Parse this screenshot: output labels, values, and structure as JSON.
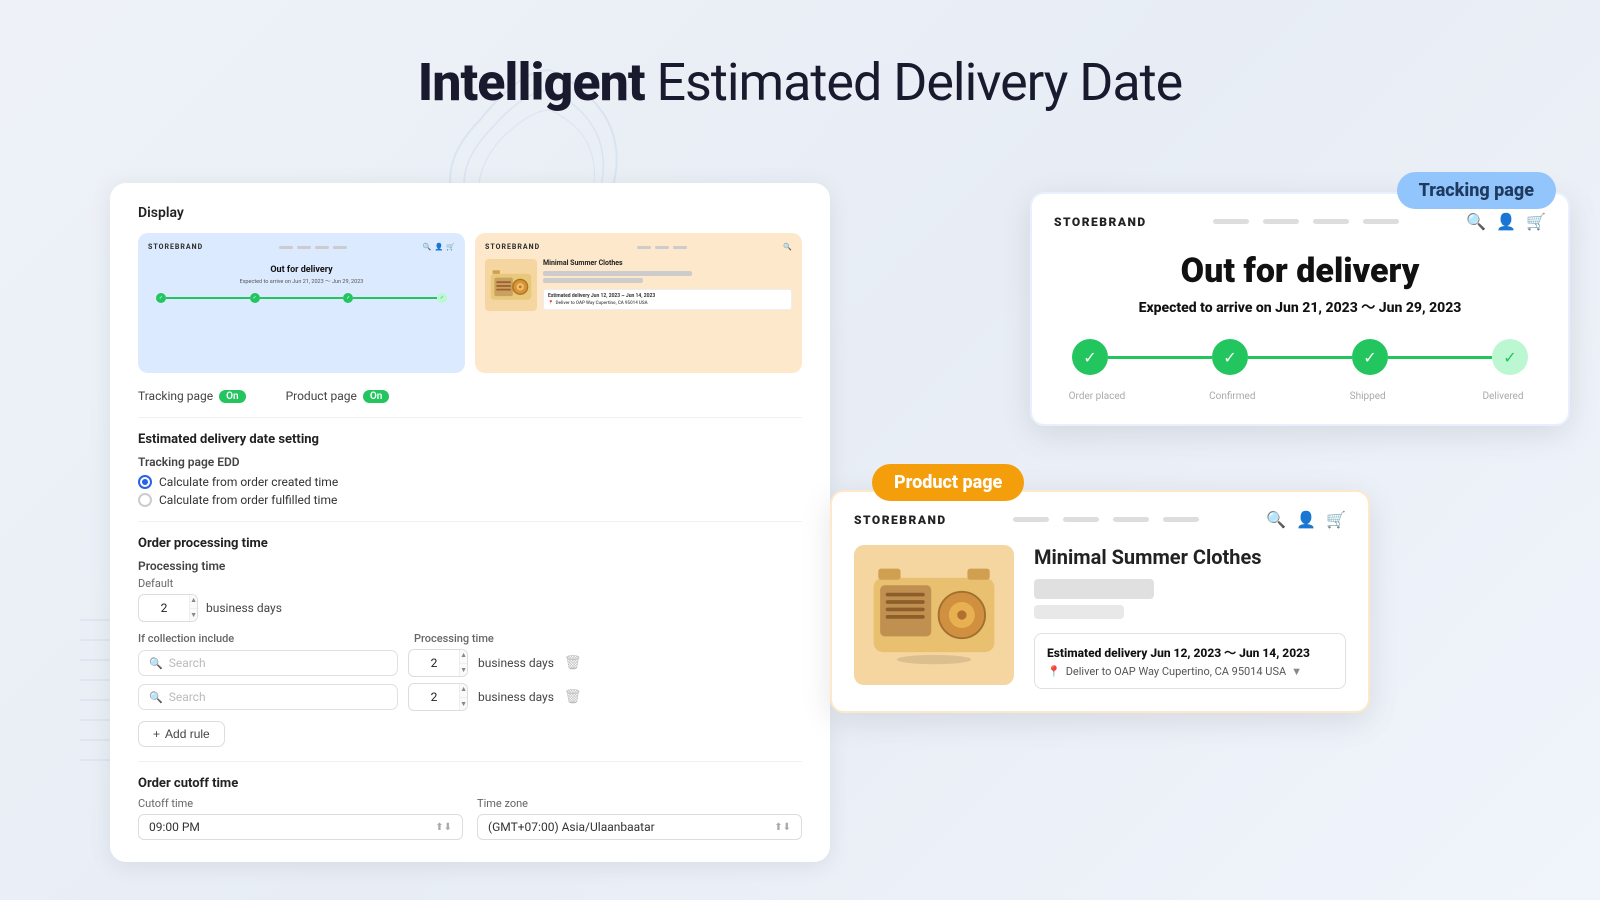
{
  "page": {
    "title_bold": "Intelligent",
    "title_normal": " Estimated Delivery Date"
  },
  "tracking_bubble": "Tracking page",
  "product_bubble": "Product page",
  "settings": {
    "display_title": "Display",
    "tracking_label": "Tracking page",
    "tracking_toggle": "On",
    "product_label": "Product page",
    "product_toggle": "On",
    "edd_section_title": "Estimated delivery date setting",
    "tracking_page_edd_label": "Tracking page EDD",
    "radio_options": [
      {
        "label": "Calculate from order created time",
        "selected": true
      },
      {
        "label": "Calculate from order fulfilled time",
        "selected": false
      }
    ],
    "order_processing_title": "Order processing time",
    "processing_time_label": "Processing time",
    "default_label": "Default",
    "default_value": "2",
    "business_days_label": "business days",
    "if_collection_include": "If collection include",
    "processing_time_col": "Processing time",
    "collection_rules": [
      {
        "search_placeholder": "Search",
        "value": "2"
      },
      {
        "search_placeholder": "Search",
        "value": "2"
      }
    ],
    "add_rule_label": "Add rule",
    "order_cutoff_title": "Order cutoff time",
    "cutoff_label": "Cutoff time",
    "timezone_label": "Time zone",
    "cutoff_value": "09:00 PM",
    "timezone_value": "(GMT+07:00) Asia/Ulaanbaatar"
  },
  "tracking_preview": {
    "store_name": "STOREBRAND",
    "main_title": "Out for delivery",
    "subtitle_prefix": "Expected to arrive on ",
    "date_range": "Jun 21, 2023 ～ Jun 29, 2023",
    "steps": [
      "",
      "",
      "",
      ""
    ],
    "step_labels": [
      "",
      "",
      "",
      ""
    ]
  },
  "product_preview": {
    "store_name": "STOREBRAND",
    "product_title": "Minimal Summer Clothes",
    "delivery_prefix": "Estimated delivery ",
    "delivery_dates": "Jun 12, 2023 ～ Jun 14, 2023",
    "location": "Deliver to OAP Way Cupertino, CA 95014 USA"
  },
  "small_tracking_preview": {
    "store_name": "STOREBRAND",
    "title": "Out for delivery",
    "sub": "Expected to arrive on Jun 21, 2023 ～ Jun 29, 2023"
  },
  "small_product_preview": {
    "store_name": "STOREBRAND",
    "product_title": "Minimal Summer Clothes",
    "delivery": "Estimated delivery Jun 12, 2023 ~ Jun 14, 2023",
    "location": "Deliver to OAP Way Cupertino, CA 95014 USA"
  }
}
